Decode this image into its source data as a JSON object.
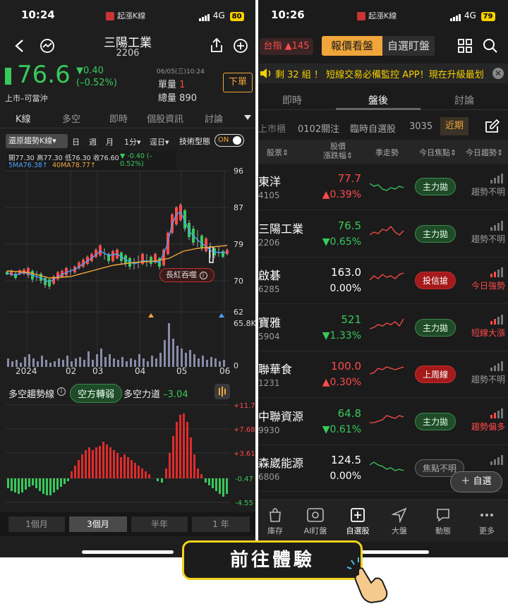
{
  "left": {
    "status": {
      "time": "10:24",
      "app": "起漲K線",
      "network": "4G",
      "battery": "80"
    },
    "header": {
      "stock_name": "三陽工業",
      "stock_code": "2206"
    },
    "quote": {
      "price": "76.6",
      "change": "▼0.40",
      "change_pct": "(–0.52%)",
      "datetime": "06/05(三)10:24",
      "single_label": "單量",
      "single_value": "1",
      "total_label": "總量",
      "total_value": "890",
      "market_note": "上市–可當沖",
      "order_button": "下單"
    },
    "tabs": [
      "K線",
      "多空",
      "即時",
      "個股資訊",
      "討論"
    ],
    "toolbar": {
      "restore": "還原趨勢K線",
      "periods": [
        "日",
        "週",
        "月",
        "1分"
      ],
      "day_selector": "逕日",
      "pattern_label": "技術型態",
      "toggle": "ON"
    },
    "ohlc": {
      "open": "開77.30",
      "high": "高77.30",
      "low": "低76.30",
      "close": "收76.60",
      "chg": "▼ -0.40 (–0.52%)"
    },
    "ma": {
      "ma5": "5MA76.38↑",
      "ma40": "40MA78.77↑"
    },
    "price_axis": [
      "96",
      "87",
      "79",
      "70",
      "62"
    ],
    "vol_axis": [
      "65.8K",
      "0"
    ],
    "x_axis": [
      "2024",
      "02",
      "03",
      "04",
      "05",
      "06"
    ],
    "pattern_tag": "長紅吞噬",
    "trend_section": {
      "title": "多空趨勢線",
      "status": "空方轉弱",
      "force_label": "多空力道",
      "force_value": "–3.04"
    },
    "osc_axis": [
      "+11.76",
      "+7.68",
      "+3.61",
      "-0.47",
      "-4.55"
    ],
    "range_buttons": [
      "1個月",
      "3個月",
      "半年",
      "1 年"
    ]
  },
  "right": {
    "status": {
      "time": "10:26",
      "app": "起漲K線",
      "network": "4G",
      "battery": "79"
    },
    "topbar": {
      "index_label": "台指 ▲145",
      "tab_active": "報價看盤",
      "tab_other": "自選盯盤"
    },
    "banner": {
      "text": "剩 32 組 ！ 短線交易必備監控 APP！現在升級最划"
    },
    "tabs": [
      "即時",
      "盤後",
      "討論"
    ],
    "filters": [
      "上市櫃",
      "0102關注",
      "臨時自選股",
      "3035",
      "近期"
    ],
    "columns": [
      "股票⇕",
      "股價\n漲跌幅⇕",
      "季走勢",
      "今日焦點⇕",
      "今日趨勢⇕"
    ],
    "rows": [
      {
        "name": "東洋",
        "code": "4105",
        "price": "77.7",
        "chg": "▲0.39%",
        "dir": "up",
        "focus": "主力拋",
        "focus_type": "green",
        "trend": "趨勢不明",
        "trend_type": "gray"
      },
      {
        "name": "三陽工業",
        "code": "2206",
        "price": "76.5",
        "chg": "▼0.65%",
        "dir": "down",
        "focus": "主力拋",
        "focus_type": "green",
        "trend": "趨勢不明",
        "trend_type": "gray"
      },
      {
        "name": "啟碁",
        "code": "6285",
        "price": "163.0",
        "chg": "0.00%",
        "dir": "flat",
        "focus": "投信搶",
        "focus_type": "red",
        "trend": "今日強勢",
        "trend_type": "red"
      },
      {
        "name": "寶雅",
        "code": "5904",
        "price": "521",
        "chg": "▼1.33%",
        "dir": "down",
        "focus": "主力拋",
        "focus_type": "green",
        "trend": "短線大漲",
        "trend_type": "red"
      },
      {
        "name": "聯華食",
        "code": "1231",
        "price": "100.0",
        "chg": "▲0.30%",
        "dir": "up",
        "focus": "上周線",
        "focus_type": "redsolid",
        "trend": "趨勢不明",
        "trend_type": "gray"
      },
      {
        "name": "中聯資源",
        "code": "9930",
        "price": "64.8",
        "chg": "▼0.61%",
        "dir": "down",
        "focus": "主力拋",
        "focus_type": "green",
        "trend": "趨勢偏多",
        "trend_type": "red"
      },
      {
        "name": "森崴能源",
        "code": "6806",
        "price": "124.5",
        "chg": "0.00%",
        "dir": "flat",
        "focus": "焦點不明",
        "focus_type": "gray",
        "trend": "",
        "trend_type": "gray"
      }
    ],
    "add_button": "＋ 自選",
    "bottom_tabs": [
      "庫存",
      "AI盯盤",
      "自選股",
      "大盤",
      "動態",
      "更多"
    ]
  },
  "cta": "前往體驗",
  "colors": {
    "up": "#ff4a4a",
    "down": "#38c95b",
    "accent": "#f0a63a",
    "cta_border": "#f3d11b"
  }
}
